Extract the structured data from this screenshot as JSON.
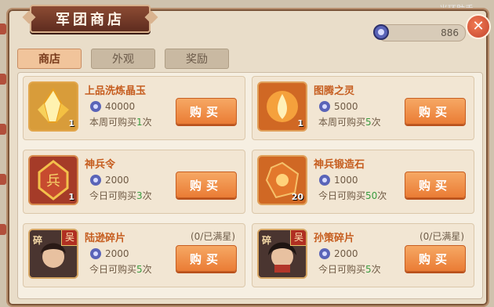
{
  "header": {
    "title": "军团商店",
    "watermark": "光环助手"
  },
  "currency": {
    "amount": "886",
    "icon": "gem-coin-icon"
  },
  "tabs": [
    {
      "label": "商店",
      "active": true
    },
    {
      "label": "外观",
      "active": false
    },
    {
      "label": "奖励",
      "active": false
    }
  ],
  "items": [
    {
      "name": "上品洗炼晶玉",
      "price": "40000",
      "limit_prefix": "本周可购买",
      "limit_count": "1",
      "limit_suffix": "次",
      "qty": "1",
      "button": "购买"
    },
    {
      "name": "图腾之灵",
      "price": "5000",
      "limit_prefix": "本周可购买",
      "limit_count": "5",
      "limit_suffix": "次",
      "qty": "1",
      "button": "购买"
    },
    {
      "name": "神兵令",
      "price": "2000",
      "limit_prefix": "今日可购买",
      "limit_count": "3",
      "limit_suffix": "次",
      "qty": "1",
      "icon_text": "兵",
      "button": "购买"
    },
    {
      "name": "神兵锻造石",
      "price": "1000",
      "limit_prefix": "今日可购买",
      "limit_count": "50",
      "limit_suffix": "次",
      "qty": "20",
      "button": "购买"
    },
    {
      "name": "陆逊碎片",
      "note": "(0/已满星)",
      "price": "2000",
      "limit_prefix": "今日可购买",
      "limit_count": "5",
      "limit_suffix": "次",
      "badge": "吴",
      "sub": "碎",
      "button": "购买"
    },
    {
      "name": "孙策碎片",
      "note": "(0/已满星)",
      "price": "2000",
      "limit_prefix": "今日可购买",
      "limit_count": "5",
      "limit_suffix": "次",
      "badge": "吴",
      "sub": "碎",
      "button": "购买"
    }
  ],
  "colors": {
    "accent": "#ea7c35",
    "name_text": "#c65d1f",
    "limit_highlight": "#3a9c3f",
    "title_bg": "#6e3525"
  }
}
